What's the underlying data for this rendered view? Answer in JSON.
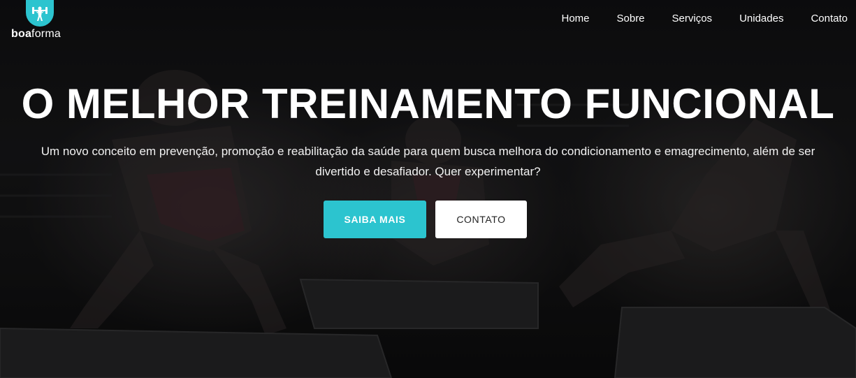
{
  "brand": {
    "name_bold": "boa",
    "name_light": "forma",
    "logo_icon": "dumbbell-person-icon",
    "accent_color": "#2cc4cf"
  },
  "nav": {
    "items": [
      {
        "label": "Home"
      },
      {
        "label": "Sobre"
      },
      {
        "label": "Serviços"
      },
      {
        "label": "Unidades"
      },
      {
        "label": "Contato"
      }
    ]
  },
  "hero": {
    "headline": "O MELHOR TREINAMENTO FUNCIONAL",
    "subtitle": "Um novo conceito em prevenção, promoção e reabilitação da saúde para quem busca melhora do condicionamento e emagrecimento, além de ser divertido e desafiador. Quer experimentar?",
    "primary_button": "SAIBA MAIS",
    "secondary_button": "CONTATO"
  }
}
